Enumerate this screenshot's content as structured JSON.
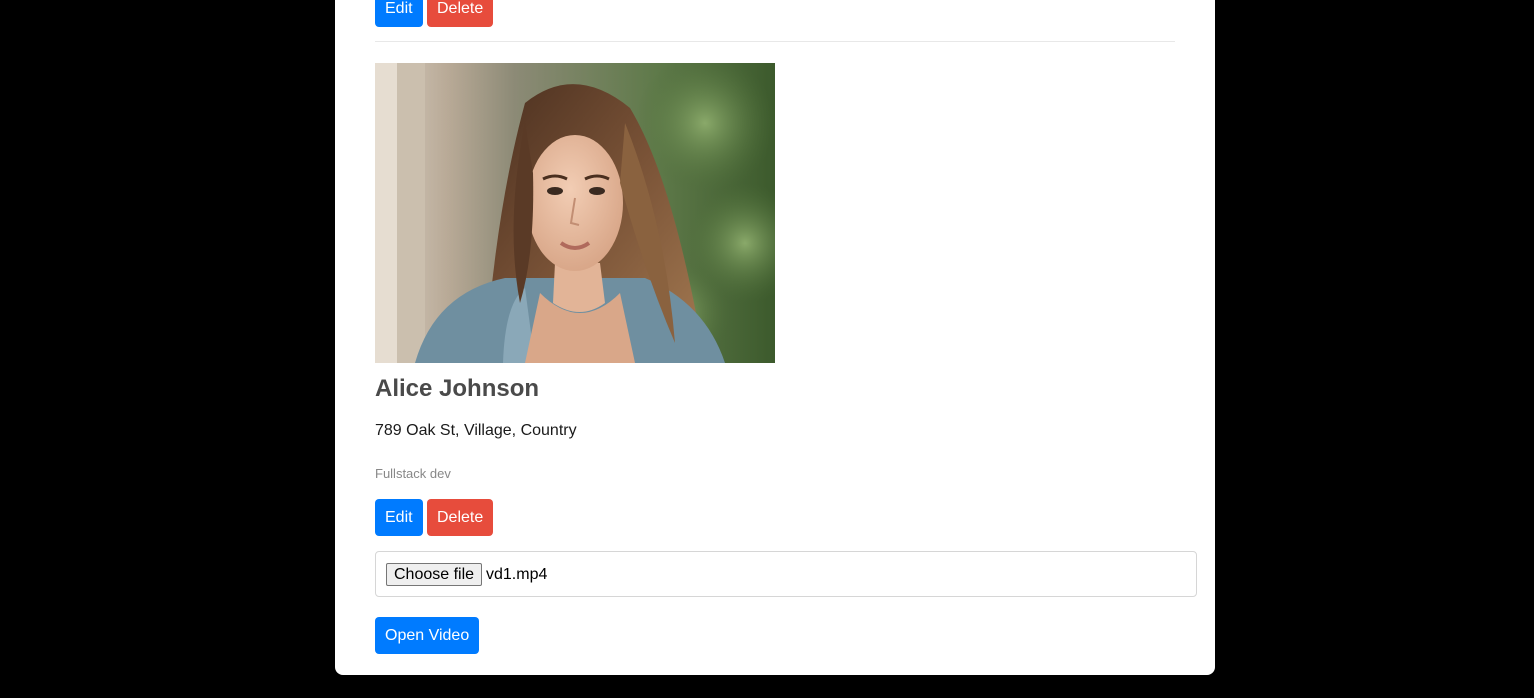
{
  "top_actions": {
    "edit_label": "Edit",
    "delete_label": "Delete"
  },
  "profile": {
    "photo_alt": "Portrait photo",
    "name": "Alice Johnson",
    "address": "789 Oak St, Village, Country",
    "role": "Fullstack dev",
    "edit_label": "Edit",
    "delete_label": "Delete"
  },
  "file_input": {
    "button_label": "Choose file",
    "file_name": "vd1.mp4"
  },
  "open_video_label": "Open Video",
  "colors": {
    "primary": "#007bff",
    "danger": "#e74c3c",
    "background": "#000000",
    "card": "#ffffff"
  }
}
